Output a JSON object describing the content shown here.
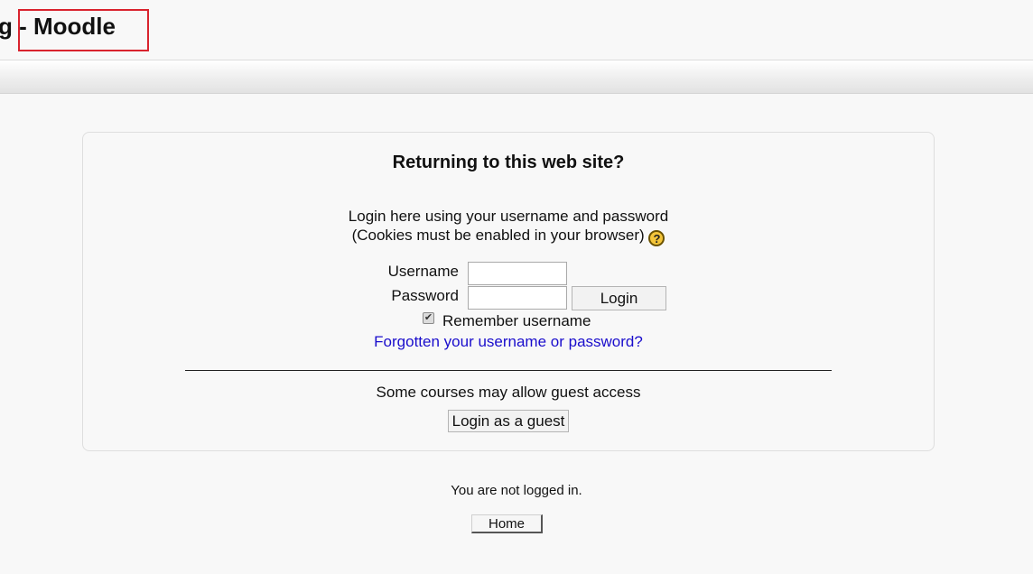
{
  "header": {
    "site_title": "g - Moodle"
  },
  "login": {
    "heading": "Returning to this web site?",
    "instructions_line1": "Login here using your username and password",
    "instructions_line2": "(Cookies must be enabled in your browser)",
    "help_icon": "question-mark",
    "username_label": "Username",
    "username_value": "",
    "password_label": "Password",
    "password_value": "",
    "login_button": "Login",
    "remember_checked": true,
    "remember_label": "Remember username",
    "forgot_link": "Forgotten your username or password?",
    "guest_text": "Some courses may allow guest access",
    "guest_button": "Login as a guest"
  },
  "footer": {
    "login_info": "You are not logged in.",
    "home_button": "Home"
  },
  "colors": {
    "link": "#1a0dcc",
    "highlight_box": "#d9232e",
    "help_icon": "#f4c53a"
  }
}
